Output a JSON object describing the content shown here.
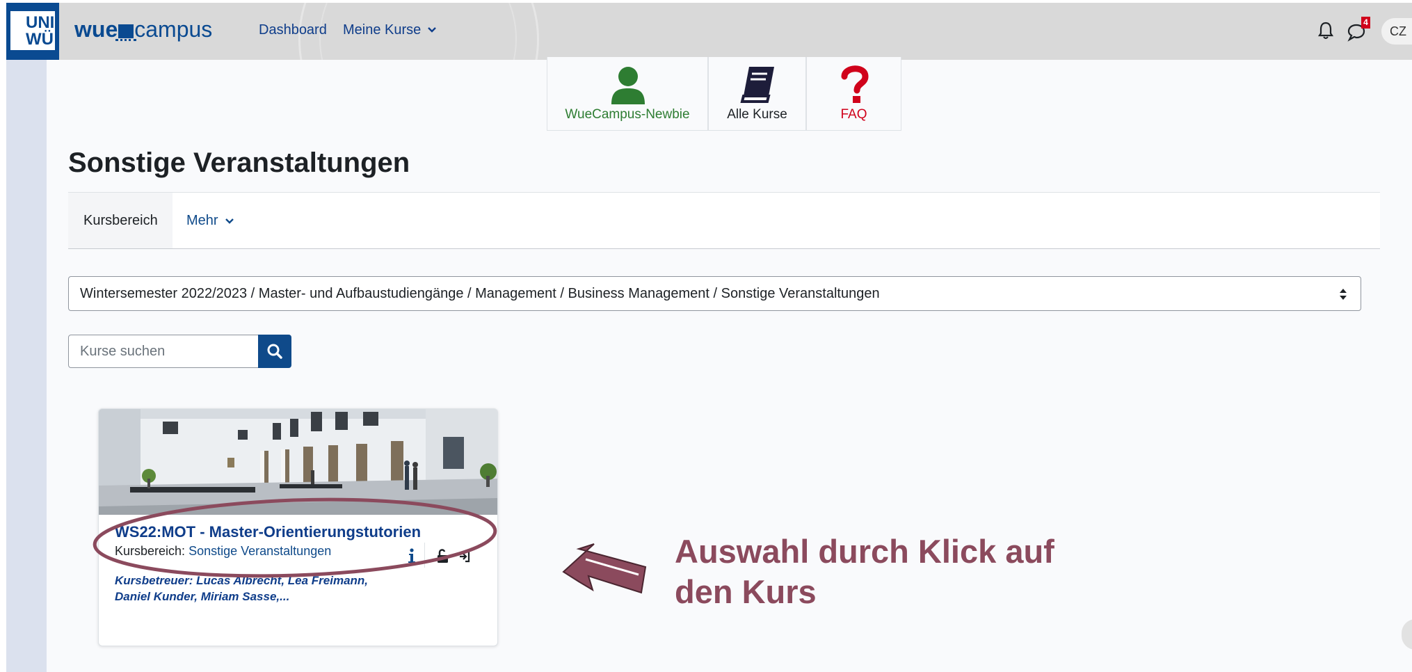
{
  "header": {
    "logo_text": "UNI\nWÜ",
    "brand_prefix": "wue",
    "brand_suffix": "campus",
    "nav": [
      {
        "label": "Dashboard"
      },
      {
        "label": "Meine Kurse"
      }
    ],
    "notification_count": "4",
    "avatar_initials": "CZ"
  },
  "tiles": [
    {
      "label": "WueCampus-Newbie",
      "color": "#2e7d32"
    },
    {
      "label": "Alle Kurse",
      "color": "#1d2125"
    },
    {
      "label": "FAQ",
      "color": "#d0021b"
    }
  ],
  "page": {
    "title": "Sonstige Veranstaltungen",
    "tabs": [
      {
        "label": "Kursbereich"
      },
      {
        "label": "Mehr"
      }
    ],
    "category_select": "Wintersemester 2022/2023 / Master- und Aufbaustudiengänge / Management / Business Management / Sonstige Veranstaltungen",
    "search_placeholder": "Kurse suchen"
  },
  "course_card": {
    "title": "WS22:MOT - Master-Orientierungstutorien",
    "category_prefix": "Kursbereich:",
    "category_link": "Sonstige Veranstaltungen",
    "teachers_line1": "Kursbetreuer: Lucas Albrecht, Lea Freimann,",
    "teachers_line2": "Daniel Kunder, Miriam Sasse,..."
  },
  "annotation": {
    "line1": "Auswahl durch Klick auf",
    "line2": "den Kurs",
    "color": "#8b4a5d"
  },
  "colors": {
    "primary": "#0f4a8a",
    "navbar_bg": "#d9d9d9"
  }
}
